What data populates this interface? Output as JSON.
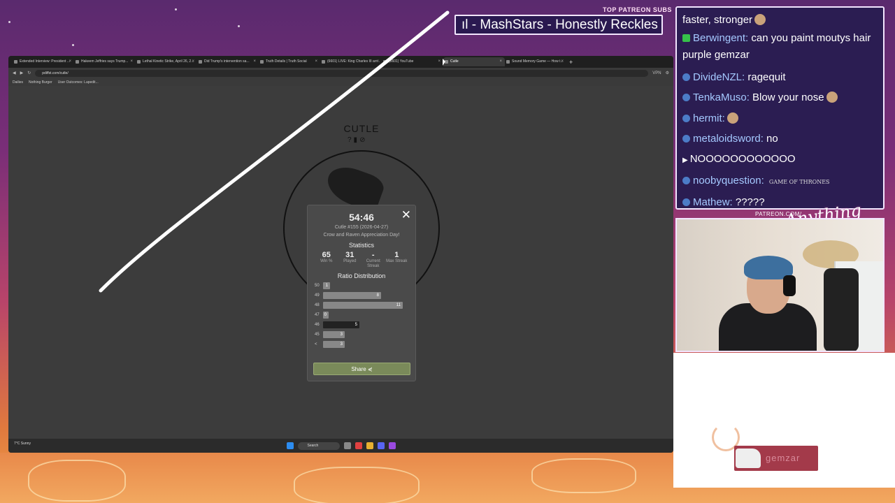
{
  "overlay": {
    "patreon_subs_label": "TOP PATREON SUBS",
    "ticker_text": "ıl - MashStars - Honestly Reckles",
    "patreon_url": "PATREON.COM/",
    "logo_text": "Anything Else?"
  },
  "browser": {
    "tabs": [
      {
        "label": "Extended Interview: President ..."
      },
      {
        "label": "Hakeem Jeffries says Trump..."
      },
      {
        "label": "Lethal Kinetic Strike, April 26, 2..."
      },
      {
        "label": "Did Trump's intervention sa..."
      },
      {
        "label": "Truth Details | Truth Social"
      },
      {
        "label": "(6601) LIVE: King Charles III arr..."
      },
      {
        "label": "(6601) YouTube"
      },
      {
        "label": "Cutle",
        "active": true
      },
      {
        "label": "Sound Memory Game — How t..."
      }
    ],
    "url": "pdiffst.com/cutle/",
    "bookmarks": [
      "Dailies",
      "Nothing Burger",
      "User Outcomes: Lapedit..."
    ],
    "vpn_label": "VPN"
  },
  "taskbar": {
    "weather": "7°C Sunny",
    "search_placeholder": "Search"
  },
  "cutle": {
    "title": "CUTLE",
    "header_icons": "?▮⊘",
    "modal": {
      "close": "✕",
      "timer": "54:46",
      "puzzle_line": "Cutle #155 (2026-04-27)",
      "theme_line": "Crow and Raven Appreciation Day!",
      "stats_heading": "Statistics",
      "stats": [
        {
          "value": "65",
          "label": "Win %"
        },
        {
          "value": "31",
          "label": "Played"
        },
        {
          "value": "-",
          "label": "Current Streak"
        },
        {
          "value": "1",
          "label": "Max Streak"
        }
      ],
      "dist_heading": "Ratio Distribution",
      "distribution": [
        {
          "label": "50",
          "value": 1
        },
        {
          "label": "49",
          "value": 8
        },
        {
          "label": "48",
          "value": 11
        },
        {
          "label": "47",
          "value": 0
        },
        {
          "label": "46",
          "value": 5,
          "current": true
        },
        {
          "label": "45",
          "value": 3
        },
        {
          "label": "<",
          "value": 3
        }
      ],
      "dist_max": 11,
      "share_label": "Share"
    }
  },
  "chat": {
    "messages": [
      {
        "user": "",
        "text": "faster, stronger",
        "emote": true
      },
      {
        "user": "Berwingent:",
        "text": " can you paint moutys hair purple gemzar",
        "badge": "green",
        "wrap": true
      },
      {
        "user": "DivideNZL:",
        "text": " ragequit"
      },
      {
        "user": "TenkaMuso:",
        "text": " Blow your nose",
        "emote": true
      },
      {
        "user": "hermit:",
        "text": "",
        "emote": true
      },
      {
        "user": "metaloidsword:",
        "text": " no"
      },
      {
        "user": "",
        "text": "NOOOOOOOOOOOO",
        "badge": "arrow"
      },
      {
        "user": "noobyquestion:",
        "text": " ",
        "got": "GAME OF THRONES"
      },
      {
        "user": "Mathew:",
        "text": " ?????"
      }
    ]
  },
  "name_tag": "gemzar"
}
